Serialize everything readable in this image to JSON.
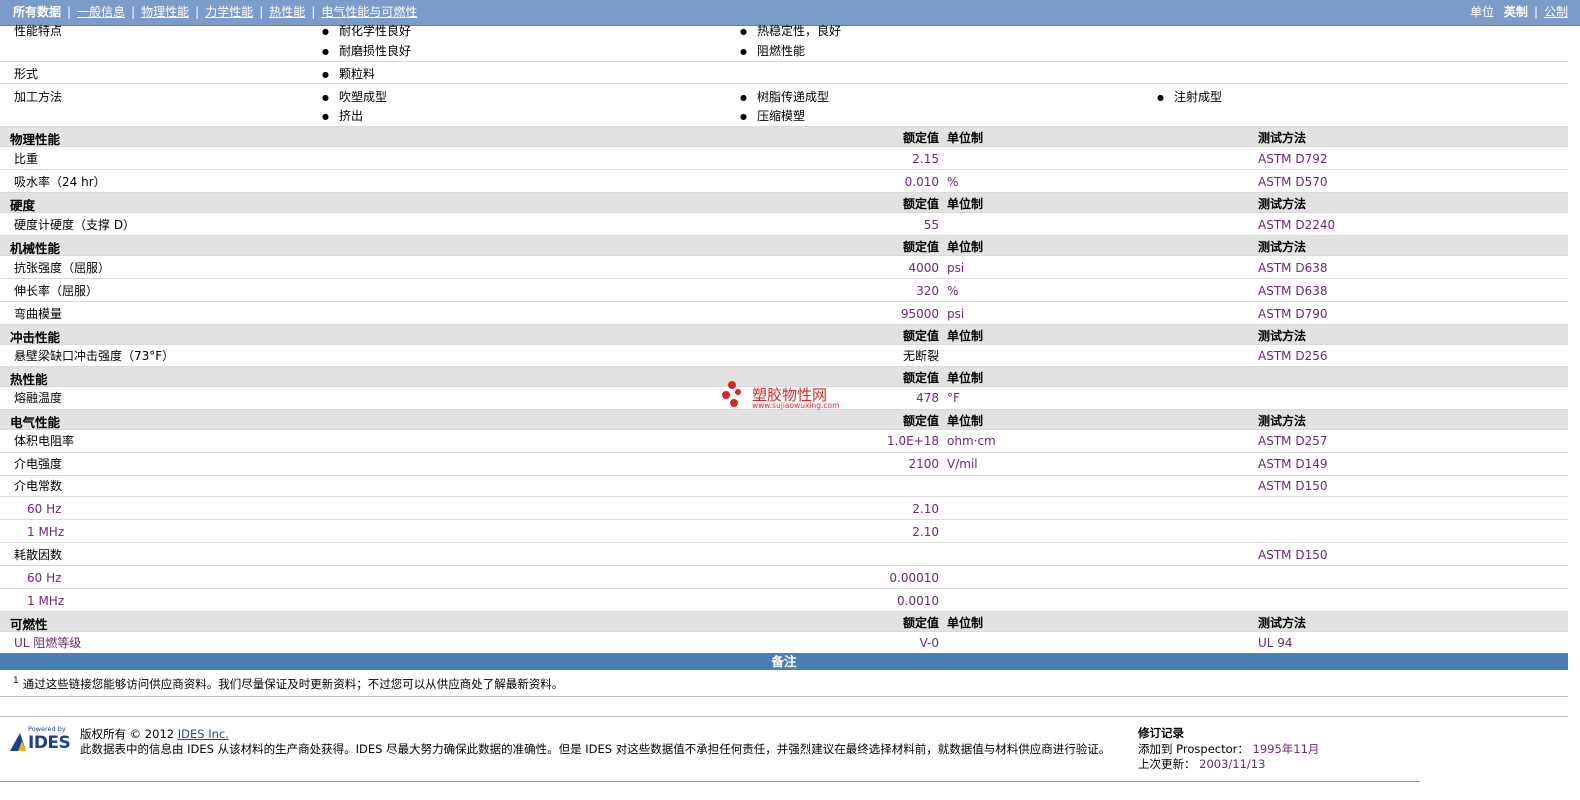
{
  "nav": {
    "all_data": "所有数据",
    "tabs": [
      "一般信息",
      "物理性能",
      "力学性能",
      "热性能",
      "电气性能与可燃性"
    ],
    "unit_label": "单位",
    "unit_imperial": "英制",
    "unit_metric": "公制"
  },
  "general": {
    "features_label": "性能特点",
    "features": [
      "耐化学性良好",
      "热稳定性，良好",
      "耐磨损性良好",
      "阻燃性能"
    ],
    "form_label": "形式",
    "form_items": [
      "颗粒料"
    ],
    "processing_label": "加工方法",
    "processing": [
      "吹塑成型",
      "树脂传递成型",
      "注射成型",
      "挤出",
      "压缩模塑"
    ]
  },
  "headers": {
    "value": "额定值",
    "unit": "单位制",
    "test": "测试方法"
  },
  "sections": {
    "physical": {
      "title": "物理性能",
      "rows": [
        {
          "label": "比重",
          "value": "2.15",
          "unit": "",
          "test": "ASTM D792"
        },
        {
          "label": "吸水率（24 hr）",
          "value": "0.010",
          "unit": "%",
          "test": "ASTM D570"
        }
      ]
    },
    "hardness": {
      "title": "硬度",
      "rows": [
        {
          "label": "硬度计硬度（支撑 D）",
          "value": "55",
          "unit": "",
          "test": "ASTM D2240"
        }
      ]
    },
    "mechanical": {
      "title": "机械性能",
      "rows": [
        {
          "label": "抗张强度（屈服）",
          "value": "4000",
          "unit": "psi",
          "test": "ASTM D638"
        },
        {
          "label": "伸长率（屈服）",
          "value": "320",
          "unit": "%",
          "test": "ASTM D638"
        },
        {
          "label": "弯曲模量",
          "value": "95000",
          "unit": "psi",
          "test": "ASTM D790"
        }
      ]
    },
    "impact": {
      "title": "冲击性能",
      "rows": [
        {
          "label": "悬壁梁缺口冲击强度（73°F）",
          "value": "无断裂",
          "unit": "",
          "test": "ASTM D256"
        }
      ]
    },
    "thermal": {
      "title": "热性能",
      "rows": [
        {
          "label": "熔融温度",
          "value": "478",
          "unit": "°F",
          "test": ""
        }
      ]
    },
    "electrical": {
      "title": "电气性能",
      "rows": [
        {
          "label": "体积电阻率",
          "value": "1.0E+18",
          "unit": "ohm·cm",
          "test": "ASTM D257"
        },
        {
          "label": "介电强度",
          "value": "2100",
          "unit": "V/mil",
          "test": "ASTM D149"
        },
        {
          "label": "介电常数",
          "value": "",
          "unit": "",
          "test": "ASTM D150"
        },
        {
          "label": "60 Hz",
          "value": "2.10",
          "unit": "",
          "test": ""
        },
        {
          "label": "1 MHz",
          "value": "2.10",
          "unit": "",
          "test": ""
        },
        {
          "label": "耗散因数",
          "value": "",
          "unit": "",
          "test": "ASTM D150"
        },
        {
          "label": "60 Hz",
          "value": "0.00010",
          "unit": "",
          "test": ""
        },
        {
          "label": "1 MHz",
          "value": "0.0010",
          "unit": "",
          "test": ""
        }
      ]
    },
    "flammability": {
      "title": "可燃性",
      "rows": [
        {
          "label": "UL 阻燃等级",
          "value": "V-0",
          "unit": "",
          "test": "UL 94"
        }
      ]
    }
  },
  "notes": {
    "title": "备注",
    "footnote_num": "1",
    "footnote": "通过这些链接您能够访问供应商资料。我们尽量保证及时更新资料；不过您可以从供应商处了解最新资料。"
  },
  "footer": {
    "logo_powered": "Powered by",
    "logo_text": "IDES",
    "copyright": "版权所有 © 2012",
    "company": "IDES Inc.",
    "disclaimer": "此数据表中的信息由 IDES 从该材料的生产商处获得。IDES 尽最大努力确保此数据的准确性。但是 IDES 对这些数据值不承担任何责任，并强烈建议在最终选择材料前，就数据值与材料供应商进行验证。",
    "rev_title": "修订记录",
    "added_label": "添加到 Prospector：",
    "added_value": "1995年11月",
    "updated_label": "上次更新：",
    "updated_value": "2003/11/13"
  },
  "watermark": {
    "text": "塑胶物性网",
    "url": "www.sujiaowuxing.com",
    "color": "#d6262d"
  },
  "colors": {
    "nav_bg": "#7b9bc9",
    "section_bg": "#e2e2e2",
    "notes_bg": "#4a7fb7",
    "value_color": "#6a2a73"
  }
}
